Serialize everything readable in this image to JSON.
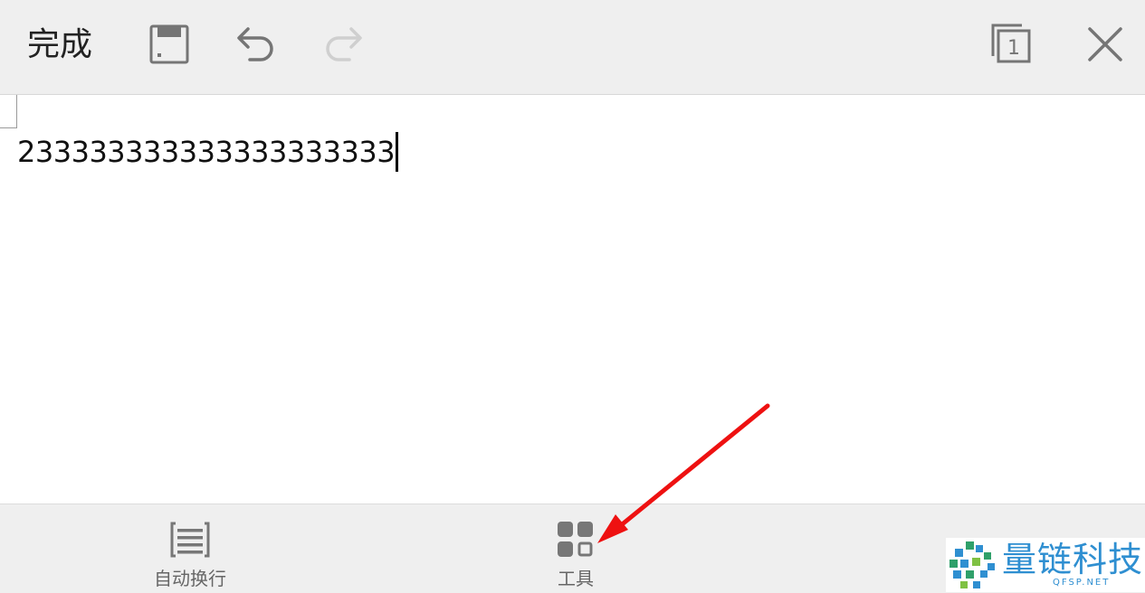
{
  "toolbar": {
    "done_label": "完成",
    "save_icon": "save-icon",
    "undo_icon": "undo-icon",
    "redo_icon": "redo-icon",
    "page_icon": "page-count-icon",
    "page_number": "1",
    "close_icon": "close-icon"
  },
  "editor": {
    "text": "233333333333333333333"
  },
  "bottom": {
    "items": [
      {
        "label": "自动换行",
        "icon": "wrap-lines-icon"
      },
      {
        "label": "工具",
        "icon": "grid-tools-icon"
      }
    ]
  },
  "annotation": {
    "arrow_color": "#ee1111"
  },
  "watermark": {
    "title": "量链科技",
    "subtitle": "QFSP.NET"
  }
}
